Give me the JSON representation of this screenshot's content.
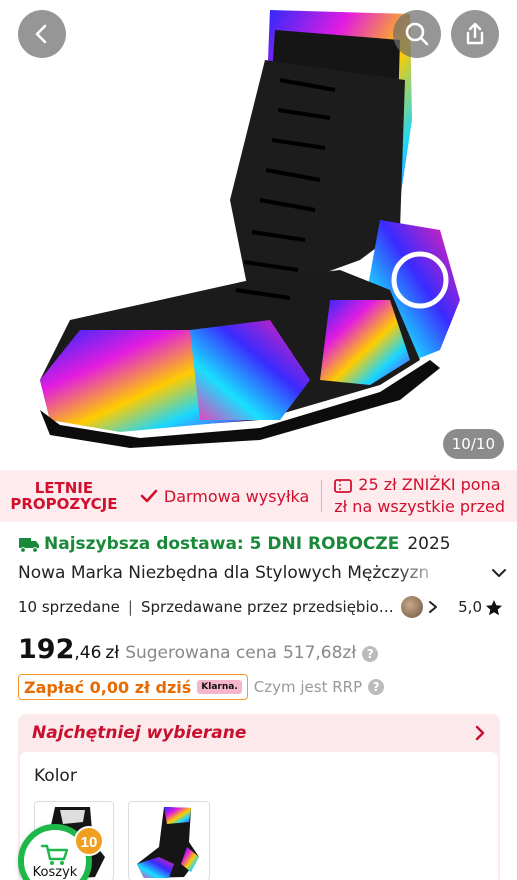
{
  "image": {
    "counter": "10/10"
  },
  "promo": {
    "title_line1": "LETNIE",
    "title_line2": "PROPOZYCJE",
    "free_shipping": "Darmowa wysyłka",
    "discount_line1": "25 zł ZNIŻKI pona",
    "discount_line2": "zł na wszystkie przed"
  },
  "product": {
    "delivery_label": "Najszybsza dostawa: 5 DNI ROBOCZE",
    "title_year": "2025",
    "title": "Nowa Marka Niezbędna dla Stylowych Mężczyzn",
    "sold": "10 sprzedane",
    "seller": "Sprzedawane przez przedsiębiorcę",
    "rating": "5,0"
  },
  "price": {
    "main": "192",
    "decimal": ",46",
    "currency": "zł",
    "rrp_label": "Sugerowana cena",
    "rrp_value": "517,68zł"
  },
  "pay": {
    "label": "Zapłać 0,00 zł dziś",
    "klarna": "Klarna.",
    "rrp_question": "Czym jest RRP"
  },
  "chosen": {
    "title": "Najchętniej wybierane",
    "color_label": "Kolor"
  },
  "cart": {
    "label": "Koszyk",
    "count": "10"
  },
  "colors": {
    "accent": "#d1102d",
    "green": "#1a8a3a",
    "orange": "#e66b00",
    "cart_ring": "#1eb84a"
  }
}
